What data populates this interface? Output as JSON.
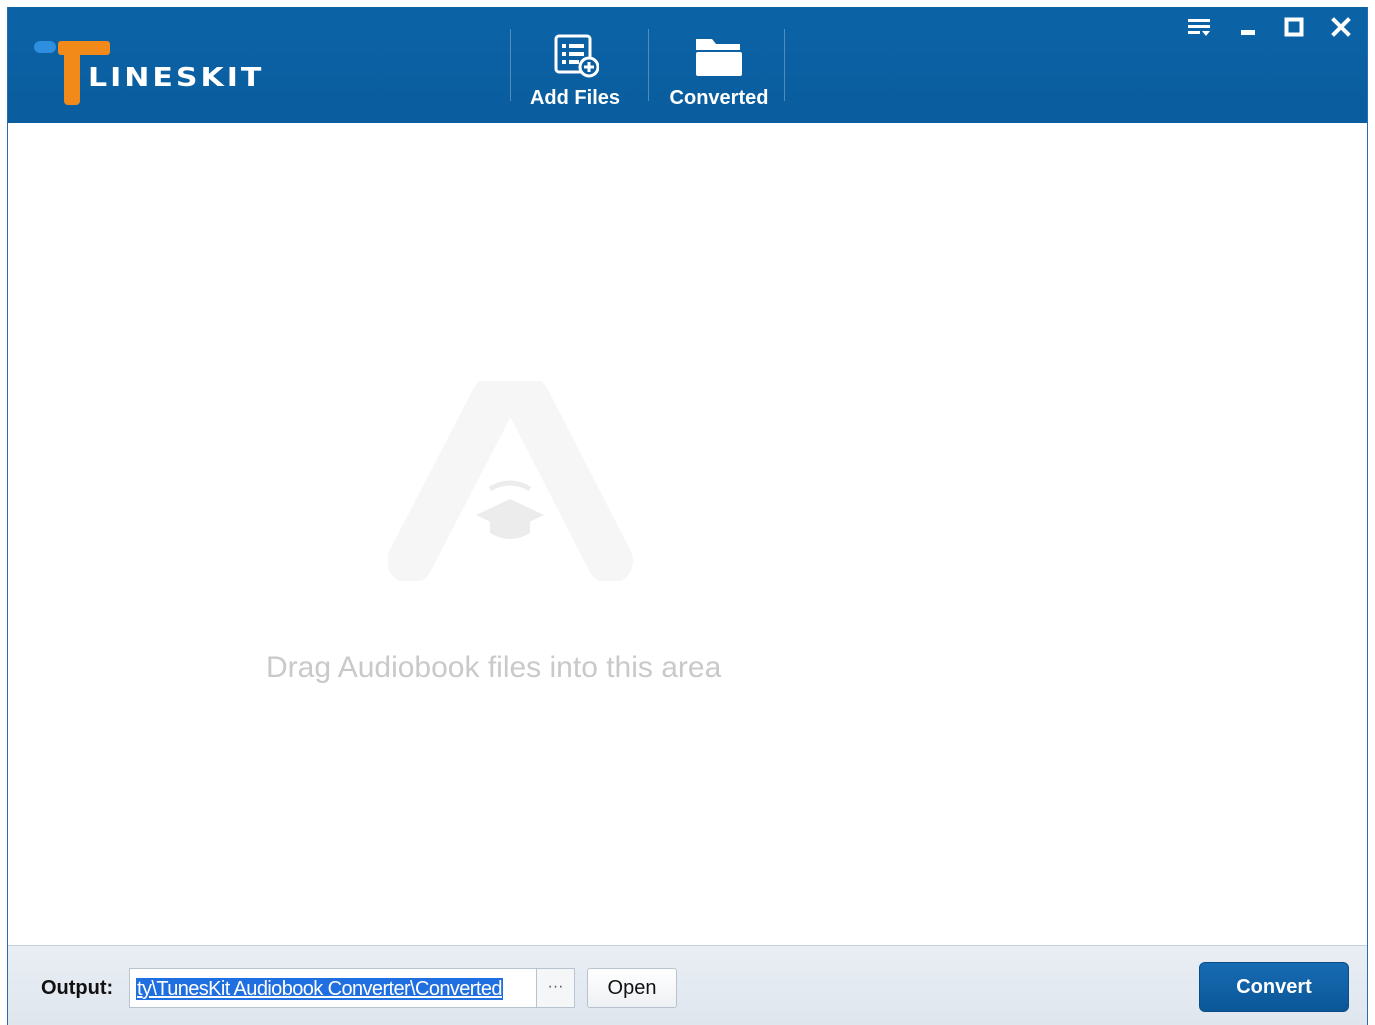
{
  "app": {
    "logo_text": "LINESKIT",
    "logo_text_display": "LINESKIT"
  },
  "toolbar": {
    "add_files_label": "Add Files",
    "converted_label": "Converted"
  },
  "window_controls": {
    "menu_icon": "menu-icon",
    "minimize_icon": "minimize-icon",
    "maximize_icon": "maximize-icon",
    "close_icon": "close-icon"
  },
  "dropzone": {
    "hint": "Drag Audiobook files into this area"
  },
  "footer": {
    "output_label": "Output:",
    "output_path": "ty\\TunesKit Audiobook Converter\\Converted",
    "browse_label": "···",
    "open_label": "Open",
    "convert_label": "Convert"
  },
  "colors": {
    "header_bg": "#0a5d9e",
    "logo_orange": "#f28a1a",
    "logo_blue": "#2e8fe0",
    "selection": "#1f6fe0",
    "convert_bg": "#0b5798"
  }
}
